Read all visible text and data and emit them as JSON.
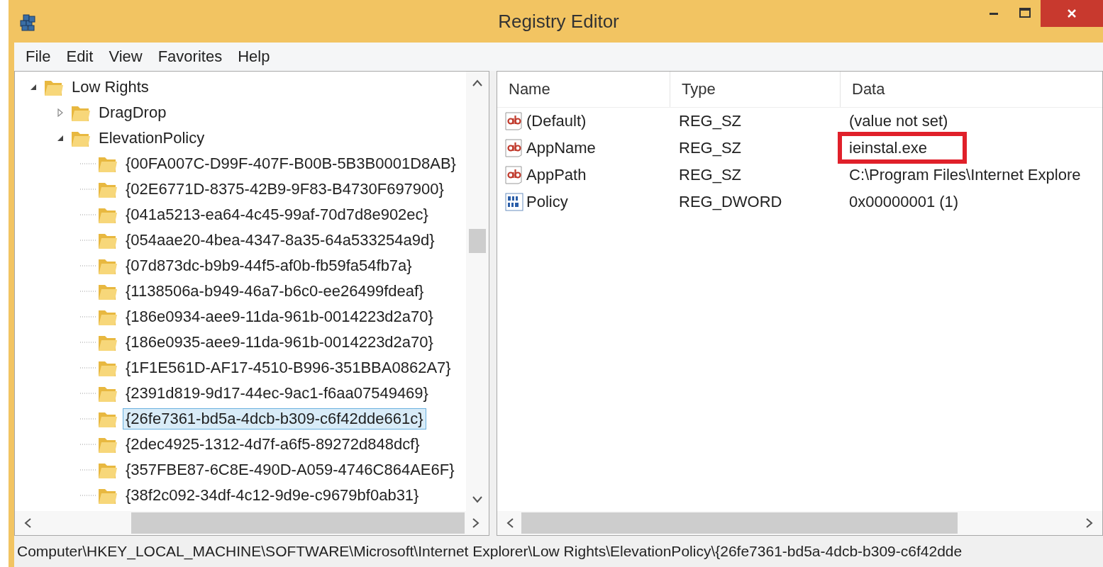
{
  "window": {
    "title": "Registry Editor"
  },
  "menu": [
    {
      "label": "File"
    },
    {
      "label": "Edit"
    },
    {
      "label": "View"
    },
    {
      "label": "Favorites"
    },
    {
      "label": "Help"
    }
  ],
  "tree": [
    {
      "label": "Low Rights",
      "expanded": true,
      "selected": false,
      "children": [
        {
          "label": "DragDrop",
          "expanded": false,
          "selected": false
        },
        {
          "label": "ElevationPolicy",
          "expanded": true,
          "selected": false,
          "children": [
            {
              "label": "{00FA007C-D99F-407F-B00B-5B3B0001D8AB}",
              "selected": false
            },
            {
              "label": "{02E6771D-8375-42B9-9F83-B4730F697900}",
              "selected": false
            },
            {
              "label": "{041a5213-ea64-4c45-99af-70d7d8e902ec}",
              "selected": false
            },
            {
              "label": "{054aae20-4bea-4347-8a35-64a533254a9d}",
              "selected": false
            },
            {
              "label": "{07d873dc-b9b9-44f5-af0b-fb59fa54fb7a}",
              "selected": false
            },
            {
              "label": "{1138506a-b949-46a7-b6c0-ee26499fdeaf}",
              "selected": false
            },
            {
              "label": "{186e0934-aee9-11da-961b-0014223d2a70}",
              "selected": false
            },
            {
              "label": "{186e0935-aee9-11da-961b-0014223d2a70}",
              "selected": false
            },
            {
              "label": "{1F1E561D-AF17-4510-B996-351BBA0862A7}",
              "selected": false
            },
            {
              "label": "{2391d819-9d17-44ec-9ac1-f6aa07549469}",
              "selected": false
            },
            {
              "label": "{26fe7361-bd5a-4dcb-b309-c6f42dde661c}",
              "selected": true
            },
            {
              "label": "{2dec4925-1312-4d7f-a6f5-89272d848dcf}",
              "selected": false
            },
            {
              "label": "{357FBE87-6C8E-490D-A059-4746C864AE6F}",
              "selected": false
            },
            {
              "label": "{38f2c092-34df-4c12-9d9e-c9679bf0ab31}",
              "selected": false
            }
          ]
        }
      ]
    }
  ],
  "values": {
    "columns": [
      "Name",
      "Type",
      "Data"
    ],
    "rows": [
      {
        "kind": "string",
        "name": "(Default)",
        "type": "REG_SZ",
        "data": "(value not set)",
        "highlighted": false
      },
      {
        "kind": "string",
        "name": "AppName",
        "type": "REG_SZ",
        "data": "ieinstal.exe",
        "highlighted": true
      },
      {
        "kind": "string",
        "name": "AppPath",
        "type": "REG_SZ",
        "data": "C:\\Program Files\\Internet Explore",
        "highlighted": false
      },
      {
        "kind": "binary",
        "name": "Policy",
        "type": "REG_DWORD",
        "data": "0x00000001 (1)",
        "highlighted": false
      }
    ]
  },
  "status_bar": "Computer\\HKEY_LOCAL_MACHINE\\SOFTWARE\\Microsoft\\Internet Explorer\\Low Rights\\ElevationPolicy\\{26fe7361-bd5a-4dcb-b309-c6f42dde"
}
